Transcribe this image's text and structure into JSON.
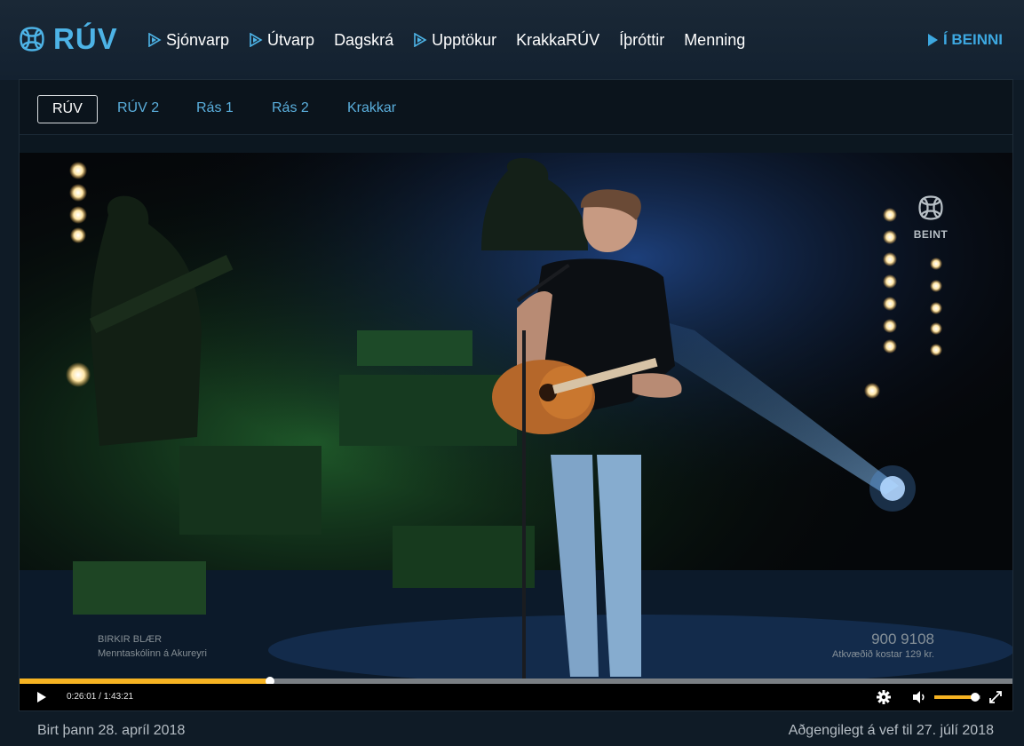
{
  "header": {
    "logo_text": "RÚV",
    "nav": [
      {
        "label": "Sjónvarp",
        "icon": "play-icon"
      },
      {
        "label": "Útvarp",
        "icon": "play-icon"
      },
      {
        "label": "Dagskrá",
        "icon": ""
      },
      {
        "label": "Upptökur",
        "icon": "play-icon"
      },
      {
        "label": "KrakkaRÚV",
        "icon": ""
      },
      {
        "label": "Íþróttir",
        "icon": ""
      },
      {
        "label": "Menning",
        "icon": ""
      }
    ],
    "live_label": "Í BEINNI"
  },
  "channels": {
    "tabs": [
      {
        "label": "RÚV",
        "active": true
      },
      {
        "label": "RÚV 2",
        "active": false
      },
      {
        "label": "Rás 1",
        "active": false
      },
      {
        "label": "Rás 2",
        "active": false
      },
      {
        "label": "Krakkar",
        "active": false
      }
    ]
  },
  "video": {
    "live_bug": "BEINT",
    "caption_name": "BIRKIR BLÆR",
    "caption_school": "Menntaskólinn á Akureyri",
    "vote_number": "900 9108",
    "vote_cost": "Atkvæðið kostar 129 kr."
  },
  "player": {
    "current_time": "0:26:01",
    "separator": " / ",
    "duration": "1:43:21",
    "progress_fraction": 0.252,
    "volume_fraction": 0.88
  },
  "footer": {
    "published": "Birt þann 28. apríl 2018",
    "available": "Aðgengilegt á vef til 27. júlí 2018"
  },
  "colors": {
    "brand": "#4db3e6",
    "progress": "#f6b322"
  }
}
